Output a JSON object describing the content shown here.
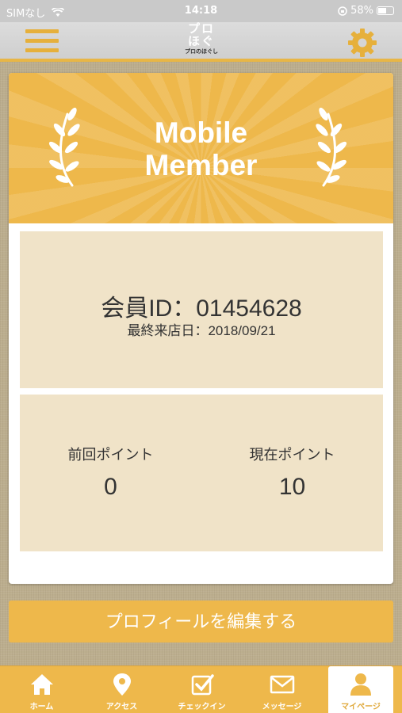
{
  "status_bar": {
    "carrier": "SIMなし",
    "time": "14:18",
    "battery": "58%"
  },
  "header": {
    "logo_line1": "プロ",
    "logo_line2": "ほぐ",
    "logo_sub": "プロのほぐし",
    "menu_icon": "hamburger-icon",
    "settings_icon": "gear-icon"
  },
  "card": {
    "banner_title_line1": "Mobile",
    "banner_title_line2": "Member",
    "member_id": "会員ID：01454628",
    "last_visit": "最終来店日：2018/09/21",
    "prev_points_label": "前回ポイント",
    "prev_points_value": "0",
    "current_points_label": "現在ポイント",
    "current_points_value": "10"
  },
  "edit_profile_label": "プロフィールを編集する",
  "tabs": [
    {
      "label": "ホーム",
      "icon": "home-icon",
      "active": false
    },
    {
      "label": "アクセス",
      "icon": "map-pin-icon",
      "active": false
    },
    {
      "label": "チェックイン",
      "icon": "checkbox-icon",
      "active": false
    },
    {
      "label": "メッセージ",
      "icon": "envelope-icon",
      "active": false
    },
    {
      "label": "マイページ",
      "icon": "person-icon",
      "active": true
    }
  ],
  "colors": {
    "accent": "#eeb84b",
    "panel": "#f0e3c8"
  }
}
